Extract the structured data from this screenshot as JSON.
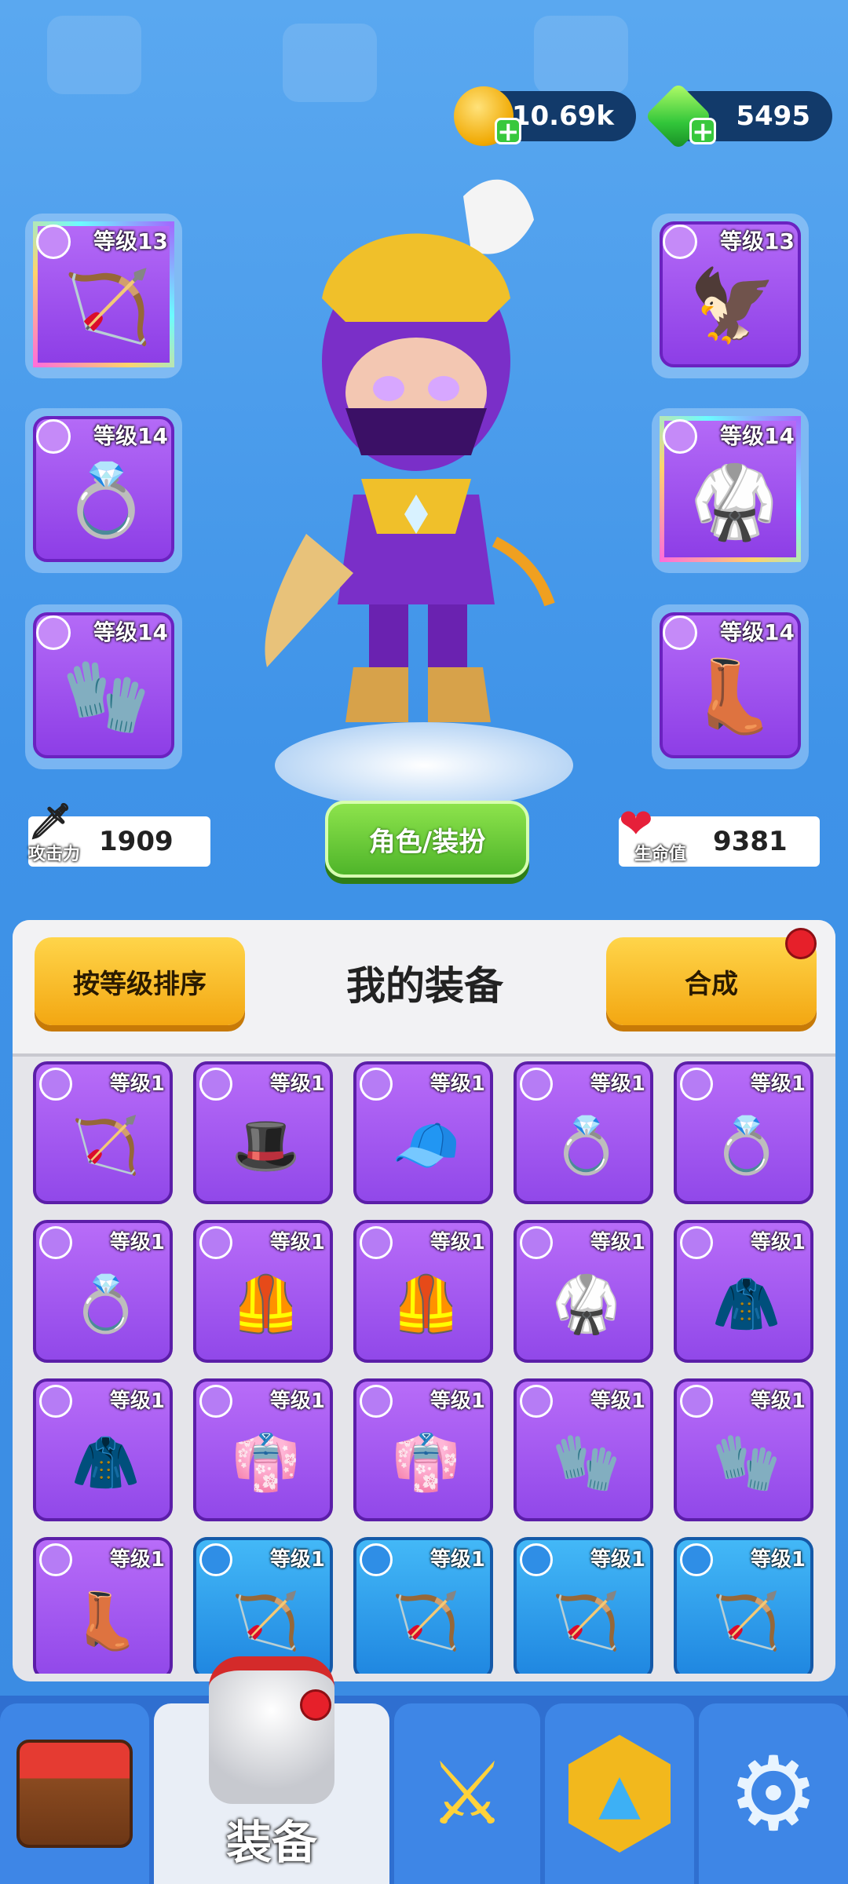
{
  "currency": {
    "gold": "10.69k",
    "gems": "5495"
  },
  "equipped_left": [
    {
      "level": "等级13",
      "icon": "golden-bow-icon",
      "rainbow": true
    },
    {
      "level": "等级14",
      "icon": "pink-ring-icon",
      "rainbow": false
    },
    {
      "level": "等级14",
      "icon": "gauntlet-icon",
      "rainbow": false
    }
  ],
  "equipped_right": [
    {
      "level": "等级13",
      "icon": "eagle-helmet-icon",
      "rainbow": false
    },
    {
      "level": "等级14",
      "icon": "armor-icon",
      "rainbow": true
    },
    {
      "level": "等级14",
      "icon": "boot-icon",
      "rainbow": false
    }
  ],
  "stats": {
    "attack_label": "攻击力",
    "attack": "1909",
    "hp_label": "生命值",
    "hp": "9381"
  },
  "role_button": "角色/装扮",
  "panel": {
    "sort_button": "按等级排序",
    "title": "我的装备",
    "merge_button": "合成"
  },
  "items": [
    {
      "level": "等级1",
      "glyph": "🏹",
      "blue": false
    },
    {
      "level": "等级1",
      "glyph": "🎩",
      "blue": false
    },
    {
      "level": "等级1",
      "glyph": "🧢",
      "blue": false
    },
    {
      "level": "等级1",
      "glyph": "💍",
      "blue": false
    },
    {
      "level": "等级1",
      "glyph": "💍",
      "blue": false
    },
    {
      "level": "等级1",
      "glyph": "💍",
      "blue": false
    },
    {
      "level": "等级1",
      "glyph": "🦺",
      "blue": false
    },
    {
      "level": "等级1",
      "glyph": "🦺",
      "blue": false
    },
    {
      "level": "等级1",
      "glyph": "🥋",
      "blue": false
    },
    {
      "level": "等级1",
      "glyph": "🧥",
      "blue": false
    },
    {
      "level": "等级1",
      "glyph": "🧥",
      "blue": false
    },
    {
      "level": "等级1",
      "glyph": "👘",
      "blue": false
    },
    {
      "level": "等级1",
      "glyph": "👘",
      "blue": false
    },
    {
      "level": "等级1",
      "glyph": "🧤",
      "blue": false
    },
    {
      "level": "等级1",
      "glyph": "🧤",
      "blue": false
    },
    {
      "level": "等级1",
      "glyph": "👢",
      "blue": false
    },
    {
      "level": "等级1",
      "glyph": "🏹",
      "blue": true
    },
    {
      "level": "等级1",
      "glyph": "🏹",
      "blue": true
    },
    {
      "level": "等级1",
      "glyph": "🏹",
      "blue": true
    },
    {
      "level": "等级1",
      "glyph": "🏹",
      "blue": true
    }
  ],
  "nav": {
    "equip_label": "装备"
  }
}
